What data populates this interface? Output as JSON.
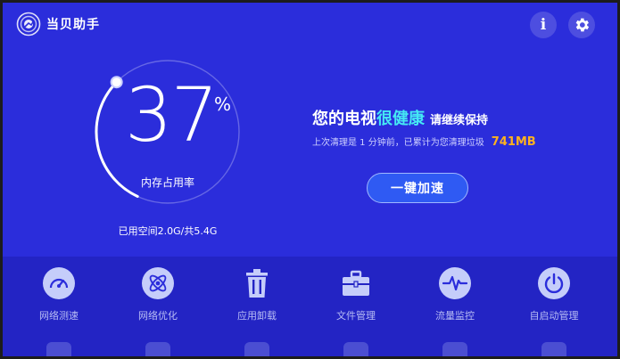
{
  "header": {
    "app_title": "当贝助手",
    "info_icon": "info-icon",
    "settings_icon": "gear-icon"
  },
  "memory": {
    "percent": "37",
    "percent_sign": "%",
    "percent_fraction": 0.37,
    "label": "内存占用率",
    "space_text": "已用空间2.0G/共5.4G"
  },
  "status": {
    "prefix": "您的电视",
    "health_word": "很健康",
    "suffix": "请继续保持",
    "cleanup_text": "上次清理是 1 分钟前，已累计为您清理垃圾",
    "junk_size": "741MB",
    "boost_button": "一键加速"
  },
  "tools": [
    {
      "label": "网络测速",
      "icon": "speedometer-icon"
    },
    {
      "label": "网络优化",
      "icon": "atom-icon"
    },
    {
      "label": "应用卸载",
      "icon": "trash-icon"
    },
    {
      "label": "文件管理",
      "icon": "briefcase-icon"
    },
    {
      "label": "流量监控",
      "icon": "pulse-icon"
    },
    {
      "label": "自启动管理",
      "icon": "power-icon"
    }
  ],
  "colors": {
    "background": "#2b2ddb",
    "tool_panel": "#2324c4",
    "accent_cyan": "#45e8f4",
    "accent_orange": "#ffb21e",
    "button_blue": "#2f5af3"
  }
}
